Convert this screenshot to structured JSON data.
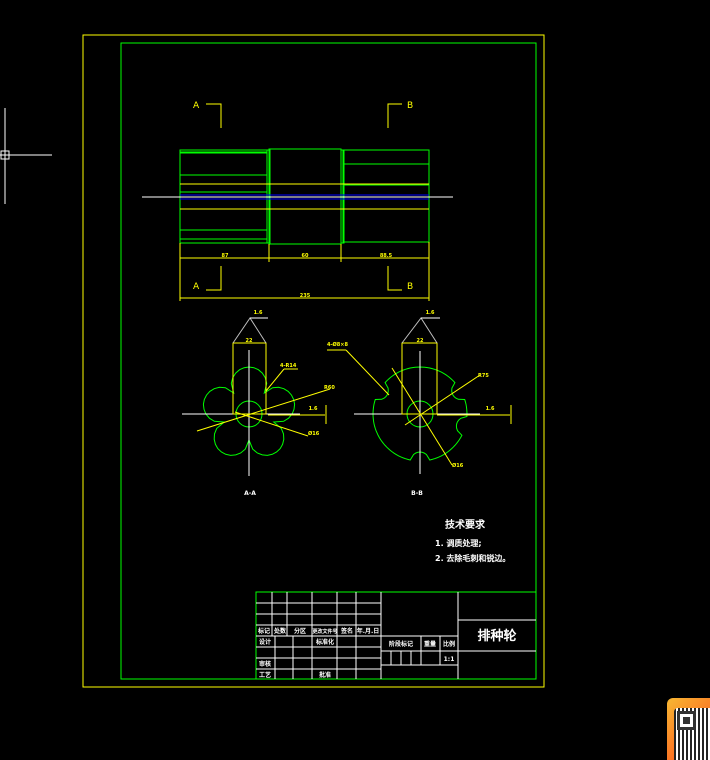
{
  "colors": {
    "background": "#000000",
    "frame": "#ffff00",
    "border": "#00ff00",
    "outline": "#00ff00",
    "dimension": "#ffff00",
    "centerline": "#ffffff",
    "axis": "#0000ff"
  },
  "main_view": {
    "section_a": "A",
    "section_b": "B",
    "dims": [
      "87",
      "60",
      "88.5",
      "235"
    ]
  },
  "section_views": {
    "aa": {
      "label": "A-A",
      "roughness": "1.6",
      "width_dim": "22",
      "leaders": [
        "4-R14",
        "R60",
        "Ø16"
      ],
      "lobes": 5
    },
    "bb": {
      "label": "B-B",
      "roughness": "1.6",
      "width_dim": "22",
      "leaders": [
        "4-Ø8×8",
        "R75",
        "Ø16"
      ],
      "notches": 4
    }
  },
  "technical_requirements": {
    "title": "技术要求",
    "items": [
      "1. 调质处理;",
      "2. 去除毛刺和锐边。"
    ]
  },
  "title_block": {
    "part_name": "排种轮",
    "header_row": [
      "标记",
      "处数",
      "分区",
      "更改文件号",
      "签名",
      "年.月.日"
    ],
    "design": "设计",
    "standardization": "标准化",
    "review": "审核",
    "process": "工艺",
    "approve": "批准",
    "stage_mark": "阶段标记",
    "weight": "重量",
    "scale_label": "比例",
    "scale": "1:1"
  },
  "qr_icon": "qr-code-icon"
}
